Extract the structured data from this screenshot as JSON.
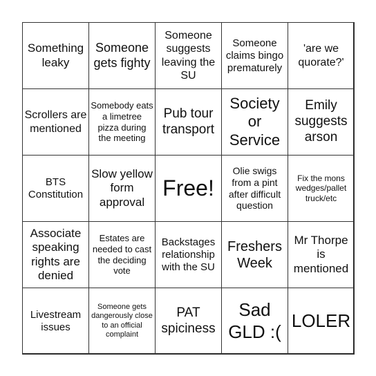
{
  "cells": [
    "Something leaky",
    "Someone gets fighty",
    "Someone suggests leaving the SU",
    "Someone claims bingo prematurely",
    "'are we quorate?'",
    "Scrollers are mentioned",
    "Somebody eats a limetree pizza during the meeting",
    "Pub tour transport",
    "Society or Service",
    "Emily suggests arson",
    "BTS Constitution",
    "Slow yellow form approval",
    "Free!",
    "Olie swigs from a pint after difficult question",
    "Fix the mons wedges/pallet truck/etc",
    "Associate speaking rights are denied",
    "Estates are needed to cast the deciding vote",
    "Backstages relationship with the SU",
    "Freshers Week",
    "Mr Thorpe is mentioned",
    "Livestream issues",
    "Someone gets dangerously close to an official complaint",
    "PAT spiciness",
    "Sad GLD :(",
    "LOLER"
  ]
}
